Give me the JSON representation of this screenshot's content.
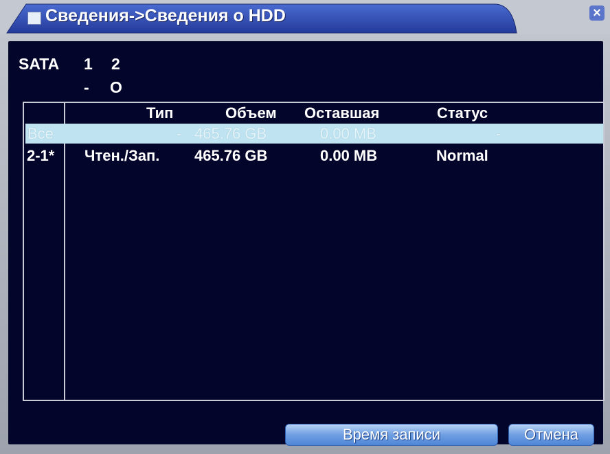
{
  "window": {
    "title": "Сведения->Сведения о HDD",
    "close_icon": "close-icon"
  },
  "sata": {
    "label": "SATA",
    "ports": [
      "1",
      "2"
    ],
    "states": [
      "-",
      "O"
    ]
  },
  "table": {
    "columns": [
      "Тип",
      "Объем",
      "Оставшая",
      "Статус"
    ],
    "rows": [
      {
        "id": "Все",
        "type": "-",
        "capacity": "465.76 GB",
        "remaining": "0.00 MB",
        "status": "-"
      },
      {
        "id": "2-1*",
        "type": "Чтен./Зап.",
        "capacity": "465.76 GB",
        "remaining": "0.00 MB",
        "status": "Normal"
      }
    ]
  },
  "buttons": {
    "record_time": "Время записи",
    "cancel": "Отмена"
  },
  "colors": {
    "panel_bg": "#04052a",
    "title_bar": "#2f4fb4",
    "highlight_row": "#bfe3f0",
    "button": "#6f9fe2"
  }
}
